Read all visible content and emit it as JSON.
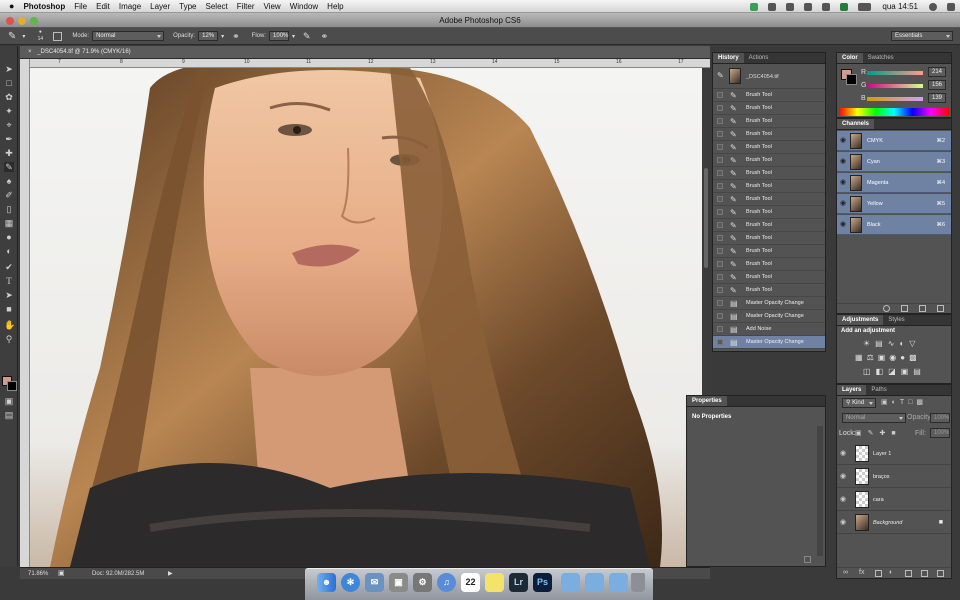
{
  "menubar": {
    "items": [
      "Photoshop",
      "File",
      "Edit",
      "Image",
      "Layer",
      "Type",
      "Select",
      "Filter",
      "View",
      "Window",
      "Help"
    ],
    "clock": "qua 14:51"
  },
  "window": {
    "title": "Adobe Photoshop CS6"
  },
  "options": {
    "brush_size": "14",
    "mode_label": "Mode:",
    "mode_value": "Normal",
    "opacity_label": "Opacity:",
    "opacity_value": "12%",
    "flow_label": "Flow:",
    "flow_value": "100%",
    "workspace": "Essentials"
  },
  "document": {
    "tab_title": "_DSC4054.tif @ 71.9% (CMYK/16)",
    "ruler_ticks": [
      "7",
      "8",
      "9",
      "10",
      "11",
      "12",
      "13",
      "14",
      "15",
      "16",
      "17"
    ],
    "zoom": "71.86%",
    "doc_size": "Doc: 92.0M/282.5M"
  },
  "history": {
    "tabs": [
      "History",
      "Actions"
    ],
    "snapshot": "_DSC4054.tif",
    "items": [
      "Brush Tool",
      "Brush Tool",
      "Brush Tool",
      "Brush Tool",
      "Brush Tool",
      "Brush Tool",
      "Brush Tool",
      "Brush Tool",
      "Brush Tool",
      "Brush Tool",
      "Brush Tool",
      "Brush Tool",
      "Brush Tool",
      "Brush Tool",
      "Brush Tool",
      "Brush Tool",
      "Master Opacity Change",
      "Master Opacity Change",
      "Add Noise",
      "Master Opacity Change"
    ],
    "selected_index": 19
  },
  "properties": {
    "title": "Properties",
    "message": "No Properties"
  },
  "color": {
    "tabs": [
      "Color",
      "Swatches"
    ],
    "r_label": "R",
    "r_value": "214",
    "g_label": "G",
    "g_value": "156",
    "b_label": "B",
    "b_value": "139",
    "foreground": "#d69c8b"
  },
  "channels": {
    "title": "Channels",
    "items": [
      {
        "name": "CMYK",
        "shortcut": "⌘2"
      },
      {
        "name": "Cyan",
        "shortcut": "⌘3"
      },
      {
        "name": "Magenta",
        "shortcut": "⌘4"
      },
      {
        "name": "Yellow",
        "shortcut": "⌘5"
      },
      {
        "name": "Black",
        "shortcut": "⌘6"
      }
    ]
  },
  "adjustments": {
    "tabs": [
      "Adjustments",
      "Styles"
    ],
    "hint": "Add an adjustment"
  },
  "layers": {
    "tabs": [
      "Layers",
      "Paths"
    ],
    "kind": "Kind",
    "blend": "Normal",
    "opacity_label": "Opacity:",
    "opacity_value": "100%",
    "lock_label": "Lock:",
    "fill_label": "Fill:",
    "fill_value": "100%",
    "items": [
      {
        "name": "Layer 1",
        "italic": false
      },
      {
        "name": "braços",
        "italic": false
      },
      {
        "name": "cara",
        "italic": false
      },
      {
        "name": "Background",
        "italic": true
      }
    ]
  },
  "dock": {
    "lr_label": "Lr",
    "ps_label": "Ps",
    "calendar_day": "22"
  }
}
